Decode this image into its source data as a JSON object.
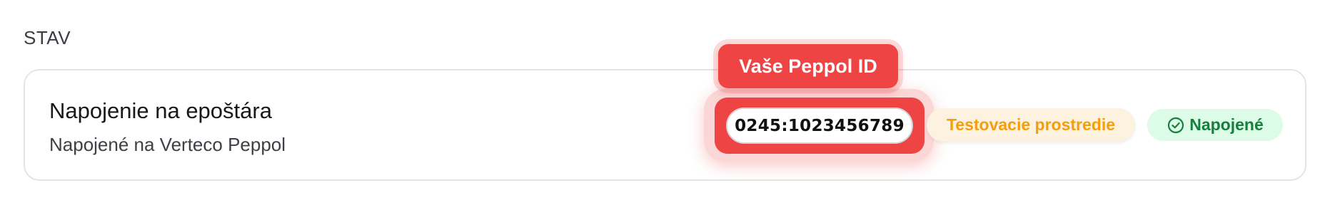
{
  "section": {
    "heading": "STAV"
  },
  "connection": {
    "title": "Napojenie na epoštára",
    "subtitle": "Napojené na Verteco Peppol",
    "peppol_id": "0245:1023456789",
    "environment_badge": "Testovacie prostredie",
    "status_badge": "Napojené",
    "status_icon": "check-circle-icon"
  },
  "callout": {
    "label": "Vaše Peppol ID"
  },
  "colors": {
    "highlight": "#ef4444",
    "environment_text": "#f59e0b",
    "environment_bg": "#fdf1df",
    "status_text": "#15803d",
    "status_bg": "#dcfce7"
  }
}
